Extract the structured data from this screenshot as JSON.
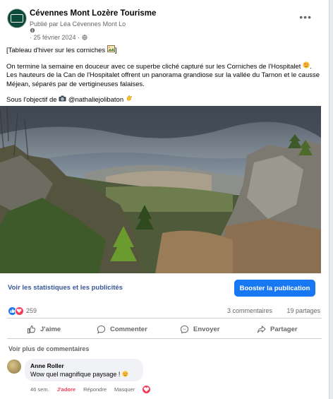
{
  "post": {
    "page_name": "Cévennes Mont Lozère Tourisme",
    "publisher": "Publié par Léa Cévennes Mont Lo",
    "date": "· 25 février 2024 ·",
    "more_icon": "more-dots-icon",
    "text_line1": "[Tableau d'hiver sur les corniches",
    "text_line1_end": "]",
    "text_para2": "On termine la semaine en douceur avec ce superbe cliché capturé sur les Corniches de l'Hospitalet",
    "text_para2b": ". Les hauteurs de la Can de l'Hospitalet offrent un panorama grandiose sur la vallée du Tarnon et le causse Méjean, séparés par de vertigineuses falaises.",
    "text_para3": "Sous l'objectif de",
    "text_para3b": "@nathaliejolibaton"
  },
  "actions_bar": {
    "stats_link": "Voir les statistiques et les publicités",
    "boost_button": "Booster la publication",
    "boost_color": "#1877f2"
  },
  "stats": {
    "reactions_count": "259",
    "comments": "3 commentaires",
    "shares": "19 partages"
  },
  "actions": {
    "like": "J'aime",
    "comment": "Commenter",
    "send": "Envoyer",
    "share": "Partager"
  },
  "comments": {
    "more": "Voir plus de commentaires",
    "items": [
      {
        "author": "Anne Roller",
        "text": "Wow quel magnifique paysage !",
        "time": "46 sem.",
        "liked": "J'adore",
        "reply": "Répondre",
        "hide": "Masquer"
      }
    ]
  }
}
